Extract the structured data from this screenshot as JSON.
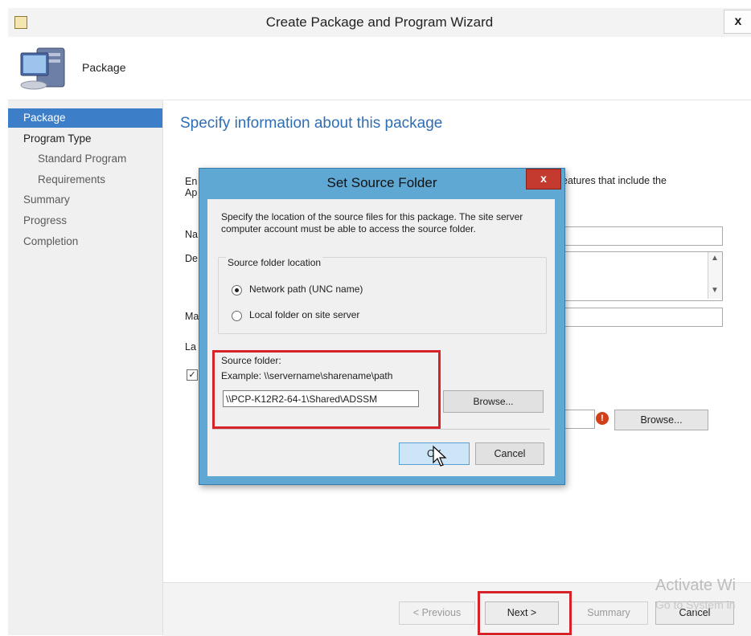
{
  "window": {
    "title": "Create Package and Program Wizard",
    "close_label": "x",
    "header_label": "Package"
  },
  "nav": {
    "items": [
      {
        "label": "Package",
        "state": "active"
      },
      {
        "label": "Program Type",
        "state": "current-section"
      },
      {
        "label": "Standard Program",
        "state": "sub"
      },
      {
        "label": "Requirements",
        "state": "sub"
      },
      {
        "label": "Summary",
        "state": "normal"
      },
      {
        "label": "Progress",
        "state": "normal"
      },
      {
        "label": "Completion",
        "state": "normal"
      }
    ]
  },
  "page": {
    "heading": "Specify information about this package",
    "desc_start": "En",
    "desc_start2": "Ap",
    "desc_tail": "eatures that include the",
    "name_label": "Na",
    "description_label": "De",
    "manufacturer_label": "Ma",
    "language_label": "La",
    "browse_label": "Browse...",
    "browse_mnemonic": "r"
  },
  "footer": {
    "previous_label": "< Previous",
    "next_label": "Next >",
    "summary_label": "Summary",
    "cancel_label": "Cancel",
    "watermark_line1": "Activate Wi",
    "watermark_line2": "Go to System in"
  },
  "dialog": {
    "title": "Set Source Folder",
    "close_label": "x",
    "instructions": "Specify the location of the source files for this package. The site server computer account must be able to access the source folder.",
    "group_label": "Source folder location",
    "radio_network_label": "Network path (UNC name)",
    "radio_local_label": "Local folder on site server",
    "selected_option": "Network path (UNC name)",
    "source_label": "Source folder:",
    "example_text": "Example: \\\\servername\\sharename\\path",
    "source_value": "\\\\PCP-K12R2-64-1\\Shared\\ADSSM",
    "browse_label": "Browse...",
    "ok_label": "OK",
    "cancel_label": "Cancel"
  },
  "colors": {
    "accent": "#3d7ec9",
    "heading": "#2f6eb5",
    "highlight_box": "#d6232a",
    "dialog_frame": "#5fa8d3",
    "dialog_close": "#c53a2f"
  }
}
